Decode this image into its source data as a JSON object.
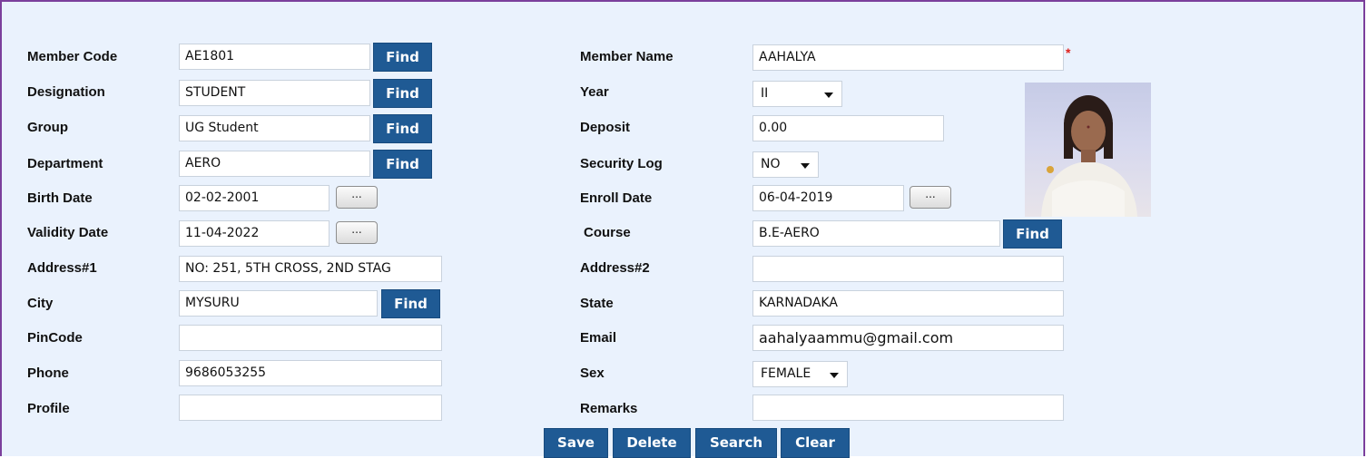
{
  "find_label": "Find",
  "dots_label": "...",
  "required_mark": "*",
  "left": {
    "member_code": {
      "label": "Member Code",
      "value": "AE1801"
    },
    "designation": {
      "label": "Designation",
      "value": "STUDENT"
    },
    "group": {
      "label": "Group",
      "value": "UG Student"
    },
    "department": {
      "label": "Department",
      "value": "AERO"
    },
    "birth_date": {
      "label": "Birth Date",
      "value": "02-02-2001"
    },
    "validity_date": {
      "label": "Validity Date",
      "value": "11-04-2022"
    },
    "address1": {
      "label": "Address#1",
      "value": "NO: 251, 5TH CROSS, 2ND STAG"
    },
    "city": {
      "label": "City",
      "value": "MYSURU"
    },
    "pincode": {
      "label": "PinCode",
      "value": ""
    },
    "phone": {
      "label": "Phone",
      "value": "9686053255"
    },
    "profile": {
      "label": "Profile",
      "value": ""
    }
  },
  "right": {
    "member_name": {
      "label": "Member Name",
      "value": "AAHALYA"
    },
    "year": {
      "label": "Year",
      "value": "II"
    },
    "deposit": {
      "label": "Deposit",
      "value": "0.00"
    },
    "security_log": {
      "label": "Security Log",
      "value": "NO"
    },
    "enroll_date": {
      "label": "Enroll Date",
      "value": "06-04-2019"
    },
    "course": {
      "label": "Course",
      "value": "B.E-AERO"
    },
    "address2": {
      "label": "Address#2",
      "value": ""
    },
    "state": {
      "label": "State",
      "value": "KARNADAKA"
    },
    "email": {
      "label": "Email",
      "value": "aahalyaammu@gmail.com"
    },
    "sex": {
      "label": "Sex",
      "value": "FEMALE"
    },
    "remarks": {
      "label": "Remarks",
      "value": ""
    }
  },
  "actions": {
    "save": "Save",
    "delete": "Delete",
    "search": "Search",
    "clear": "Clear"
  },
  "colors": {
    "panel_bg": "#eaf2fd",
    "panel_border": "#7b3f9c",
    "button_bg": "#1f5a94",
    "required": "#e0201b"
  },
  "icons": {
    "select_caret": "caret-down-icon",
    "photo": "member-photo"
  }
}
